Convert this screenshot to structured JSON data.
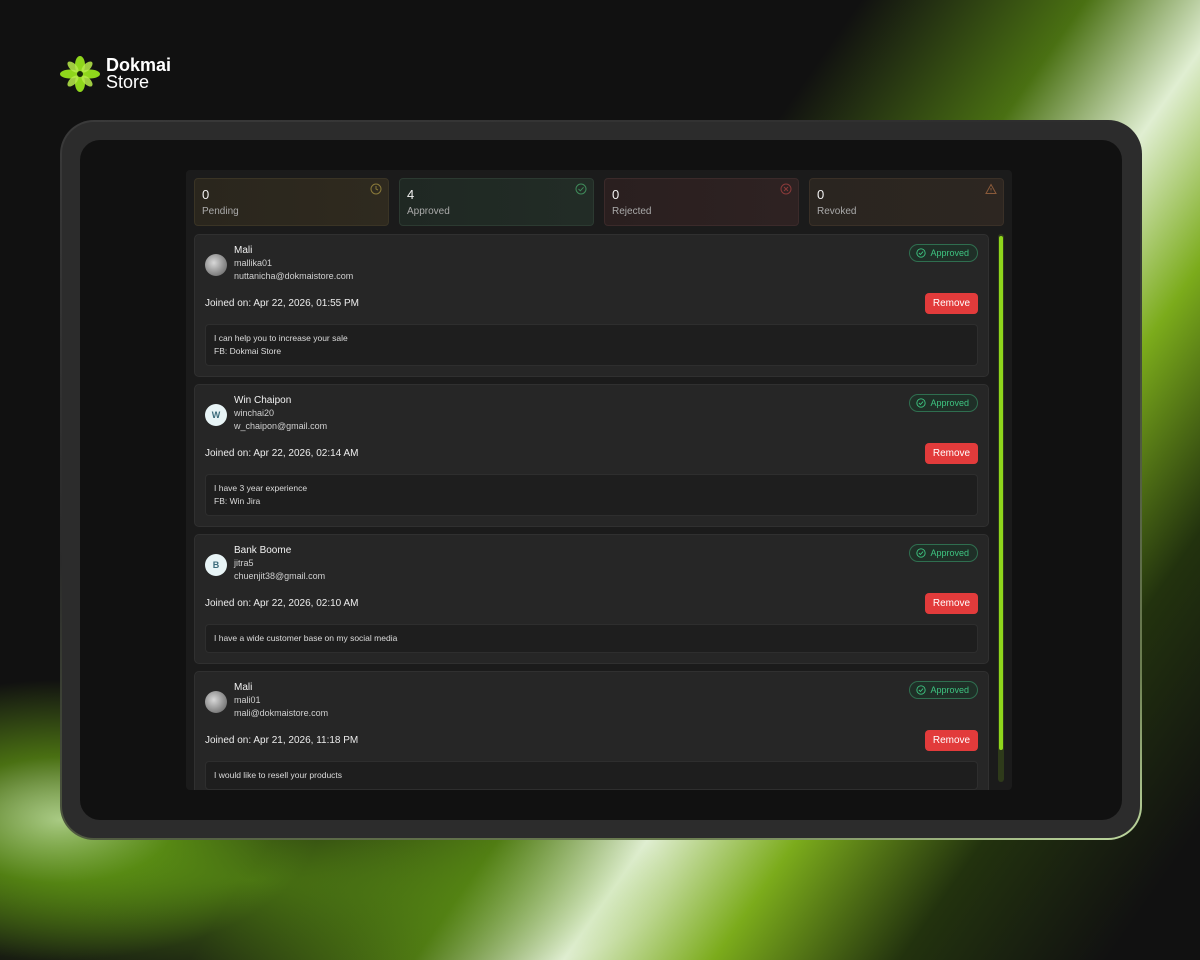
{
  "brand": {
    "line1": "Dokmai",
    "line2": "Store"
  },
  "stats": [
    {
      "count": "0",
      "label": "Pending",
      "icon": "clock-icon",
      "color": "#8a7a3a"
    },
    {
      "count": "4",
      "label": "Approved",
      "icon": "check-circle-icon",
      "color": "#3f8a5a"
    },
    {
      "count": "0",
      "label": "Rejected",
      "icon": "x-circle-icon",
      "color": "#8a3a3a"
    },
    {
      "count": "0",
      "label": "Revoked",
      "icon": "warning-icon",
      "color": "#8a5a3a"
    }
  ],
  "members": [
    {
      "name": "Mali",
      "username": "mallika01",
      "email": "nuttanicha@dokmaistore.com",
      "avatar": "photo",
      "initial": "",
      "status": "Approved",
      "joined": "Joined on: Apr 22, 2026, 01:55 PM",
      "remove_label": "Remove",
      "message_lines": [
        "I can help you to increase your sale",
        "FB: Dokmai Store"
      ]
    },
    {
      "name": "Win Chaipon",
      "username": "winchai20",
      "email": "w_chaipon@gmail.com",
      "avatar": "letter",
      "initial": "W",
      "status": "Approved",
      "joined": "Joined on: Apr 22, 2026, 02:14 AM",
      "remove_label": "Remove",
      "message_lines": [
        "I have 3 year experience",
        "FB: Win Jira"
      ]
    },
    {
      "name": "Bank Boome",
      "username": "jitra5",
      "email": "chuenjit38@gmail.com",
      "avatar": "letter",
      "initial": "B",
      "status": "Approved",
      "joined": "Joined on: Apr 22, 2026, 02:10 AM",
      "remove_label": "Remove",
      "message_lines": [
        "I have a wide customer base on my social media"
      ]
    },
    {
      "name": "Mali",
      "username": "mali01",
      "email": "mali@dokmaistore.com",
      "avatar": "photo",
      "initial": "",
      "status": "Approved",
      "joined": "Joined on: Apr 21, 2026, 11:18 PM",
      "remove_label": "Remove",
      "message_lines": [
        "I would like to resell your products"
      ]
    }
  ],
  "colors": {
    "accent": "#8fd61c",
    "approved": "#3ec481",
    "danger": "#e23b3b"
  }
}
